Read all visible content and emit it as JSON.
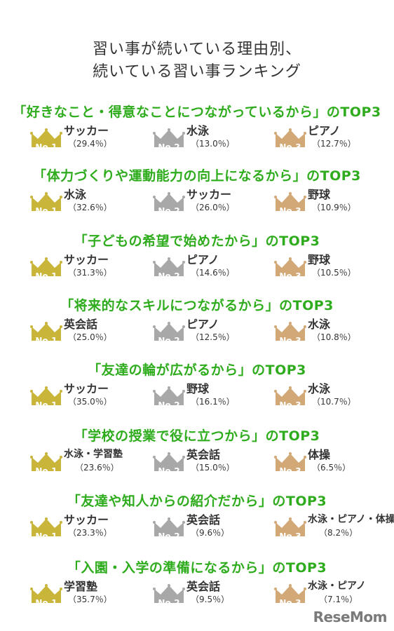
{
  "title_line1": "習い事が続いている理由別、",
  "title_line2": "続いている習い事ランキング",
  "crown_colors": [
    "#c8b53a",
    "#a8a8a8",
    "#d2a876"
  ],
  "rank_labels": [
    "No.1",
    "No.2",
    "No.3"
  ],
  "sections": [
    {
      "heading": "「好きなこと・得意なことにつながっているから」のTOP3",
      "items": [
        {
          "name": "サッカー",
          "pct": "（29.4％）"
        },
        {
          "name": "水泳",
          "pct": "（13.0％）"
        },
        {
          "name": "ピアノ",
          "pct": "（12.7％）"
        }
      ]
    },
    {
      "heading": "「体力づくりや運動能力の向上になるから」のTOP3",
      "items": [
        {
          "name": "水泳",
          "pct": "（32.6％）"
        },
        {
          "name": "サッカー",
          "pct": "（26.0％）"
        },
        {
          "name": "野球",
          "pct": "（10.9％）"
        }
      ]
    },
    {
      "heading": "「子どもの希望で始めたから」のTOP3",
      "items": [
        {
          "name": "サッカー",
          "pct": "（31.3％）"
        },
        {
          "name": "ピアノ",
          "pct": "（14.6％）"
        },
        {
          "name": "野球",
          "pct": "（10.5％）"
        }
      ]
    },
    {
      "heading": "「将来的なスキルにつながるから」のTOP3",
      "items": [
        {
          "name": "英会話",
          "pct": "（25.0％）"
        },
        {
          "name": "ピアノ",
          "pct": "（12.5％）"
        },
        {
          "name": "水泳",
          "pct": "（10.8％）"
        }
      ]
    },
    {
      "heading": "「友達の輪が広がるから」のTOP3",
      "items": [
        {
          "name": "サッカー",
          "pct": "（35.0％）"
        },
        {
          "name": "野球",
          "pct": "（16.1％）"
        },
        {
          "name": "水泳",
          "pct": "（10.7％）"
        }
      ]
    },
    {
      "heading": "「学校の授業で役に立つから」のTOP3",
      "items": [
        {
          "name": "水泳・学習塾",
          "pct": "（23.6％）"
        },
        {
          "name": "英会話",
          "pct": "（15.0％）"
        },
        {
          "name": "体操",
          "pct": "（6.5％）"
        }
      ]
    },
    {
      "heading": "「友達や知人からの紹介だから」のTOP3",
      "items": [
        {
          "name": "サッカー",
          "pct": "（23.3％）"
        },
        {
          "name": "英会話",
          "pct": "（9.6％）"
        },
        {
          "name": "水泳・ピアノ・体操",
          "pct": "（8.2％）"
        }
      ]
    },
    {
      "heading": "「入園・入学の準備になるから」のTOP3",
      "items": [
        {
          "name": "学習塾",
          "pct": "（35.7％）"
        },
        {
          "name": "英会話",
          "pct": "（9.5％）"
        },
        {
          "name": "水泳・ピアノ",
          "pct": "（7.1％）"
        }
      ]
    }
  ],
  "logo": "ReseMom"
}
